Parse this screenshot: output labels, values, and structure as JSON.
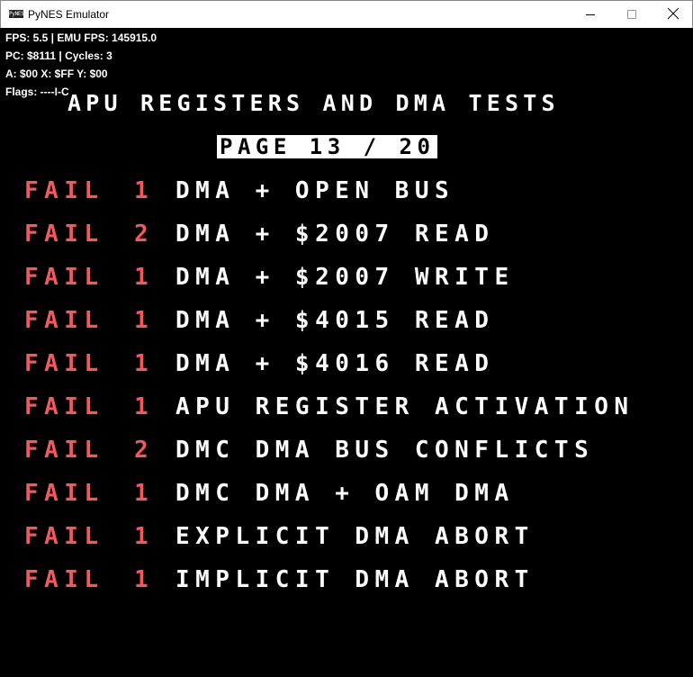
{
  "window": {
    "title": "PyNES Emulator",
    "icon_label": "PyNES"
  },
  "debug": {
    "fps_line": "FPS: 5.5 | EMU FPS: 145915.0",
    "pc_line": "PC: $8111 | Cycles: 3",
    "regs_line": "A: $00 X: $FF Y: $00",
    "flags_line": "Flags: ----I-C"
  },
  "screen": {
    "heading": "APU REGISTERS AND DMA TESTS",
    "page_indicator": "PAGE 13 / 20",
    "tests": [
      {
        "status": "FAIL",
        "code": "1",
        "name": "DMA + OPEN BUS"
      },
      {
        "status": "FAIL",
        "code": "2",
        "name": "DMA + $2007 READ"
      },
      {
        "status": "FAIL",
        "code": "1",
        "name": "DMA + $2007 WRITE"
      },
      {
        "status": "FAIL",
        "code": "1",
        "name": "DMA + $4015 READ"
      },
      {
        "status": "FAIL",
        "code": "1",
        "name": "DMA + $4016 READ"
      },
      {
        "status": "FAIL",
        "code": "1",
        "name": "APU REGISTER ACTIVATION"
      },
      {
        "status": "FAIL",
        "code": "2",
        "name": "DMC DMA BUS CONFLICTS"
      },
      {
        "status": "FAIL",
        "code": "1",
        "name": "DMC DMA + OAM DMA"
      },
      {
        "status": "FAIL",
        "code": "1",
        "name": "EXPLICIT DMA ABORT"
      },
      {
        "status": "FAIL",
        "code": "1",
        "name": "IMPLICIT DMA ABORT"
      }
    ]
  },
  "colors": {
    "fail": "#f05a5a",
    "text": "#ffffff",
    "background": "#000000"
  }
}
